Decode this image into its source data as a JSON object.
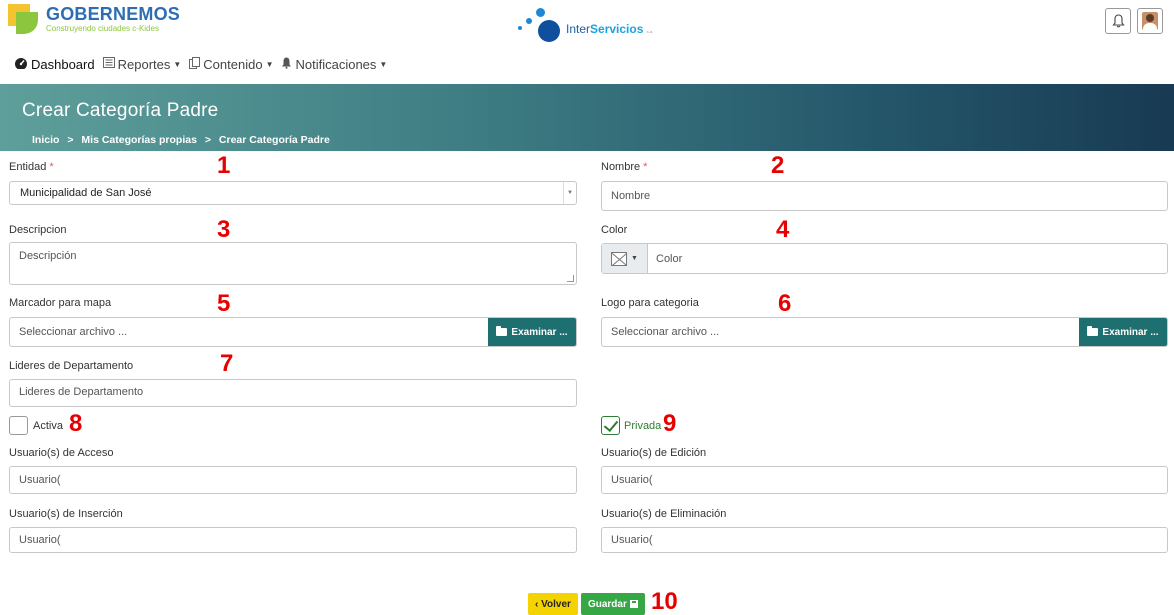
{
  "header": {
    "brand_title": "GOBERNEMOS",
    "brand_tagline": "Construyendo ciudades c-Kides",
    "partner_name_a": "Inter",
    "partner_name_b": "Servicios",
    "partner_suffix": "s.a."
  },
  "nav": {
    "items": [
      {
        "label": "Dashboard",
        "icon": "tachometer-icon"
      },
      {
        "label": "Reportes",
        "icon": "list-icon"
      },
      {
        "label": "Contenido",
        "icon": "copy-icon"
      },
      {
        "label": "Notificaciones",
        "icon": "bell-icon"
      }
    ]
  },
  "banner": {
    "title": "Crear Categoría Padre",
    "breadcrumb": [
      "Inicio",
      ">",
      "Mis Categorías propias",
      ">",
      "Crear Categoría Padre"
    ]
  },
  "form": {
    "entidad": {
      "label": "Entidad",
      "required": "*",
      "value": "Municipalidad de San José"
    },
    "nombre": {
      "label": "Nombre",
      "required": "*",
      "placeholder": "Nombre"
    },
    "descripcion": {
      "label": "Descripcion",
      "placeholder": "Descripción"
    },
    "color": {
      "label": "Color",
      "placeholder": "Color"
    },
    "marcador": {
      "label": "Marcador para mapa",
      "placeholder": "Seleccionar archivo ...",
      "button": "Examinar ..."
    },
    "logo": {
      "label": "Logo para categoria",
      "placeholder": "Seleccionar archivo ...",
      "button": "Examinar ..."
    },
    "lideres": {
      "label": "Lideres de Departamento",
      "placeholder": "Lideres de Departamento"
    },
    "activa": {
      "label": "Activa",
      "checked": false
    },
    "privada": {
      "label": "Privada",
      "checked": true
    },
    "acceso": {
      "label": "Usuario(s) de Acceso",
      "placeholder": "Usuario("
    },
    "edicion": {
      "label": "Usuario(s) de Edición",
      "placeholder": "Usuario("
    },
    "insercion": {
      "label": "Usuario(s) de Inserción",
      "placeholder": "Usuario("
    },
    "eliminacion": {
      "label": "Usuario(s) de Eliminación",
      "placeholder": "Usuario("
    }
  },
  "actions": {
    "back": "Volver",
    "save": "Guardar"
  },
  "annotations": [
    "1",
    "2",
    "3",
    "4",
    "5",
    "6",
    "7",
    "8",
    "9",
    "10"
  ],
  "colors": {
    "accent": "#1d6f70",
    "save": "#35a845",
    "back": "#f5d300",
    "annotation": "#e60000"
  }
}
